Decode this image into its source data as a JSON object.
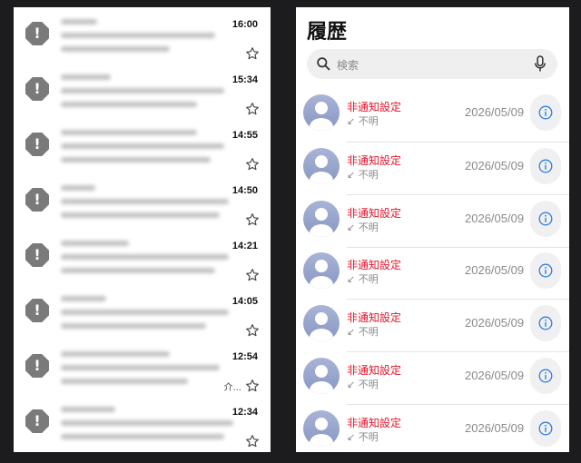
{
  "left_panel": {
    "emails": [
      {
        "time": "16:00",
        "snippet_end": ""
      },
      {
        "time": "15:34",
        "snippet_end": ""
      },
      {
        "time": "14:55",
        "snippet_end": ""
      },
      {
        "time": "14:50",
        "snippet_end": ""
      },
      {
        "time": "14:21",
        "snippet_end": ""
      },
      {
        "time": "14:05",
        "snippet_end": ""
      },
      {
        "time": "12:54",
        "snippet_end": "介..."
      },
      {
        "time": "12:34",
        "snippet_end": ""
      }
    ]
  },
  "right_panel": {
    "title": "履歴",
    "search": {
      "placeholder": "検索"
    },
    "calls": [
      {
        "name": "非通知設定",
        "type": "不明",
        "date": "2026/05/09"
      },
      {
        "name": "非通知設定",
        "type": "不明",
        "date": "2026/05/09"
      },
      {
        "name": "非通知設定",
        "type": "不明",
        "date": "2026/05/09"
      },
      {
        "name": "非通知設定",
        "type": "不明",
        "date": "2026/05/09"
      },
      {
        "name": "非通知設定",
        "type": "不明",
        "date": "2026/05/09"
      },
      {
        "name": "非通知設定",
        "type": "不明",
        "date": "2026/05/09"
      },
      {
        "name": "非通知設定",
        "type": "不明",
        "date": "2026/05/09"
      }
    ]
  },
  "colors": {
    "missed_call_red": "#e8122a",
    "info_blue": "#2f7fe0",
    "mail_icon_gray": "#7a7a7a"
  }
}
